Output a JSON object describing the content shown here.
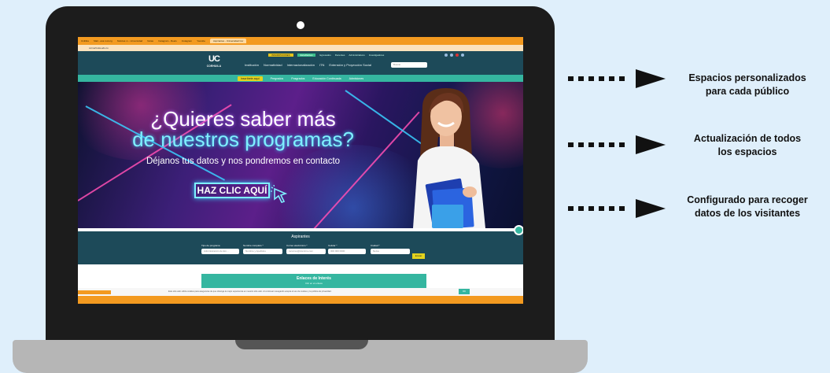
{
  "browser": {
    "tabs": [
      "Unilibre",
      "Mail - ana rod.org",
      "Noticias m - Universidad",
      "Notas",
      "Instagram - Reels",
      "Instagram",
      "Youtube",
      "Aspirantes - Universidad Cor"
    ],
    "url": "cornerfoula.edu.co"
  },
  "site": {
    "top_links": [
      "Estudiantes",
      "Egresados",
      "Docentes",
      "Administrativos",
      "Investigadores"
    ],
    "top_highlight": "INSCRIPCIONES",
    "logo_mark": "UC",
    "logo_word": "CORHUILA",
    "nav": [
      "Institución",
      "Normatividad",
      "Internacionalización",
      "ITN",
      "Extensión y Proyección Social"
    ],
    "search_placeholder": "Buscar",
    "green_nav": [
      "Inscríbete aquí",
      "Pregrados",
      "Posgrados",
      "Educación Continuada",
      "Admisiones"
    ]
  },
  "hero": {
    "line1": "¿Quieres saber más",
    "line2": "de nuestros programas?",
    "subtitle": "Déjanos tus datos y nos pondremos en contacto",
    "cta": "HAZ CLIC AQUÍ"
  },
  "form": {
    "title": "Aspirantes",
    "fields": [
      {
        "label": "Tipo de programa",
        "value": "Administración de Em..."
      },
      {
        "label": "Nombre completo *",
        "value": "Nombre y Apellidos"
      },
      {
        "label": "Correo electrónico *",
        "value": "tucorreo@dominio.com"
      },
      {
        "label": "Celular *",
        "value": "300 000 0000"
      },
      {
        "label": "Ciudad *",
        "value": "Neiva"
      }
    ],
    "submit": "Enviar"
  },
  "links_box": {
    "title": "Enlaces de Interés",
    "subtitle": "Clic en el enlace"
  },
  "cookie": {
    "text": "Este sitio web utiliza cookies para asegurarse de que obtenga la mejor experiencia en nuestro sitio web. Al continuar navegando acepta el uso de cookies y la política de privacidad.",
    "ok": "OK"
  },
  "annotations": [
    {
      "line1": "Espacios personalizados",
      "line2": "para cada público"
    },
    {
      "line1": "Actualización de todos",
      "line2": "los espacios"
    },
    {
      "line1": "Configurado para recoger",
      "line2": "datos de los visitantes"
    }
  ],
  "colors": {
    "background": "#dfeffb",
    "laptop_frame": "#1c1c1c",
    "laptop_base": "#b6b6b6",
    "site_navy": "#1d4a59",
    "site_teal": "#35b6a0",
    "browser_orange": "#f39a20",
    "hero_cyan": "#7ff0ff"
  }
}
